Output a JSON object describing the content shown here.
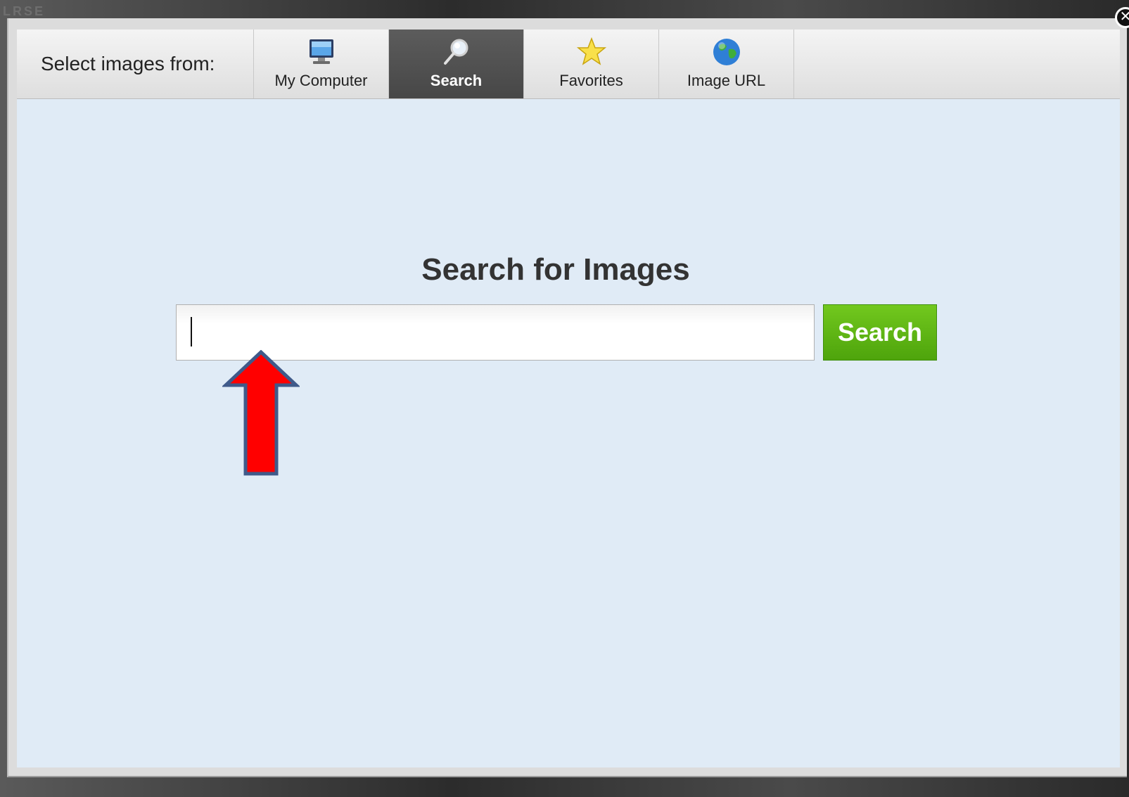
{
  "backdrop": {
    "letters": "LRSE"
  },
  "dialog": {
    "close_icon": "close-icon",
    "tabbar": {
      "label": "Select images from:",
      "tabs": [
        {
          "label": "My Computer",
          "icon": "monitor-icon",
          "active": false
        },
        {
          "label": "Search",
          "icon": "magnifier-icon",
          "active": true
        },
        {
          "label": "Favorites",
          "icon": "star-icon",
          "active": false
        },
        {
          "label": "Image URL",
          "icon": "globe-icon",
          "active": false
        }
      ]
    },
    "search": {
      "heading": "Search for Images",
      "input_value": "",
      "input_placeholder": "",
      "button_label": "Search"
    },
    "annotation": {
      "arrow_color": "#ff0000",
      "arrow_outline": "#3f5a8a"
    },
    "colors": {
      "content_bg": "#e0ebf6",
      "active_tab_bg": "#4f4f4f",
      "search_button_bg": "#5cb313"
    }
  }
}
